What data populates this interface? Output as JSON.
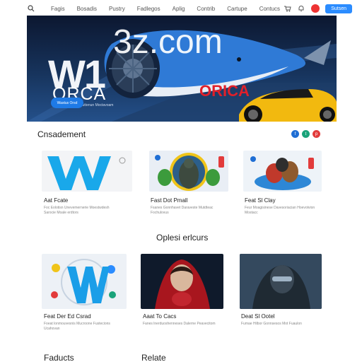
{
  "nav": {
    "links": [
      "Fagis",
      "Bosadis",
      "Pustry",
      "Fadlegos",
      "Aplig",
      "Contrib",
      "Cartupe",
      "Contucs"
    ],
    "user_label": "Sutsen"
  },
  "hero": {
    "watermark": "3z.com",
    "big_letters": "W1",
    "brand": "ORCA",
    "tagline": "Fau Eartvorovoum uttenun Moctavoam",
    "red_brand": "ORICA",
    "cta_label": "Wastus Orsd"
  },
  "sections": {
    "featured_title": "Cnsadement",
    "middle_title": "Oplesi erlcurs",
    "footer_left": "Faducts",
    "footer_right": "Relate"
  },
  "featured_cards": [
    {
      "title": "Aat Fcate",
      "desc": "Foc Eolotisn Unevemernerie Moestwdesh Sarocie Moale erdtors"
    },
    {
      "title": "Fast Dot Pmall",
      "desc": "Fsanes Gonnhavet Daraveste Mutdteac Fochulovus"
    },
    {
      "title": "Feat Sl Clay",
      "desc": "Feur Moagisinese Davesoriacian Hoevotvion Mostacc"
    }
  ],
  "recommend_cards": [
    {
      "title": "Feat Der Ed Csrad",
      "desc": "Foeat lonmouvesnis Mucroone Fustecions Ucahovan"
    },
    {
      "title": "Aaat To Cacs",
      "desc": "Fanes lnerduoshenneses Dalerne Peavecitom"
    },
    {
      "title": "Deat Sl Ootel",
      "desc": "Fumae Hilbor Gonnsesos Mot Fuaulon"
    }
  ],
  "colors": {
    "accent": "#2b8cff",
    "share": [
      "#1f6ed4",
      "#1aa37a",
      "#e23b3b"
    ]
  },
  "icons": [
    "search-icon",
    "cart-icon",
    "bell-icon",
    "share-icon"
  ]
}
